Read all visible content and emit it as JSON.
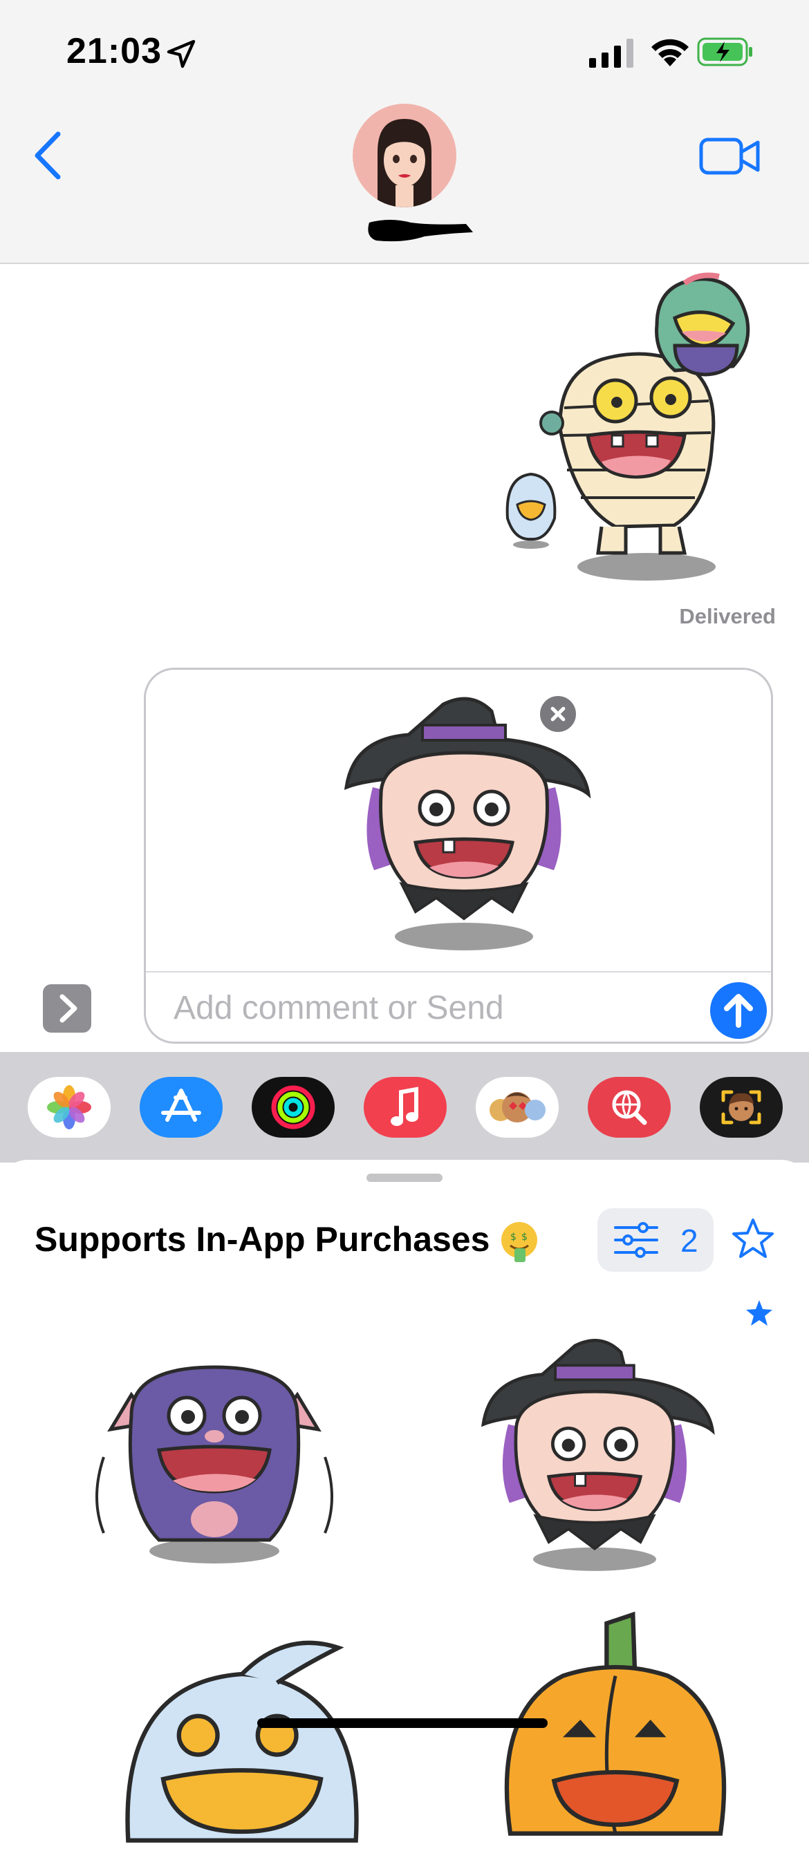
{
  "status_bar": {
    "time": "21:03",
    "icons": [
      "location-arrow-icon",
      "cellular-signal-icon",
      "wifi-icon",
      "battery-charging-icon"
    ]
  },
  "header": {
    "back_icon": "chevron-left-icon",
    "avatar": "memoji-avatar",
    "video_icon": "video-camera-icon"
  },
  "conversation": {
    "sent_sticker": "monster-trio-sticker",
    "delivered_label": "Delivered"
  },
  "compose": {
    "attached_sticker": "witch-sticker",
    "remove_icon": "close-icon",
    "input_placeholder": "Add comment or Send",
    "input_value": "",
    "send_icon": "arrow-up-icon",
    "expand_icon": "chevron-right-icon"
  },
  "app_drawer": {
    "apps": [
      "Photos",
      "App Store",
      "Activity",
      "Music",
      "Memoji Stickers",
      "Search",
      "Animoji"
    ]
  },
  "sticker_panel": {
    "title": "Supports In-App Purchases",
    "title_emoji": "money-mouth-face",
    "filter_count": "2",
    "stickers": [
      "bat-monster-sticker",
      "witch-sticker",
      "ghost-sticker",
      "pumpkin-sticker"
    ]
  },
  "colors": {
    "accent": "#1676ff",
    "secondary_text": "#8e8e93",
    "panel_bg": "#ffffff",
    "strip_bg": "#d2d2d6"
  }
}
